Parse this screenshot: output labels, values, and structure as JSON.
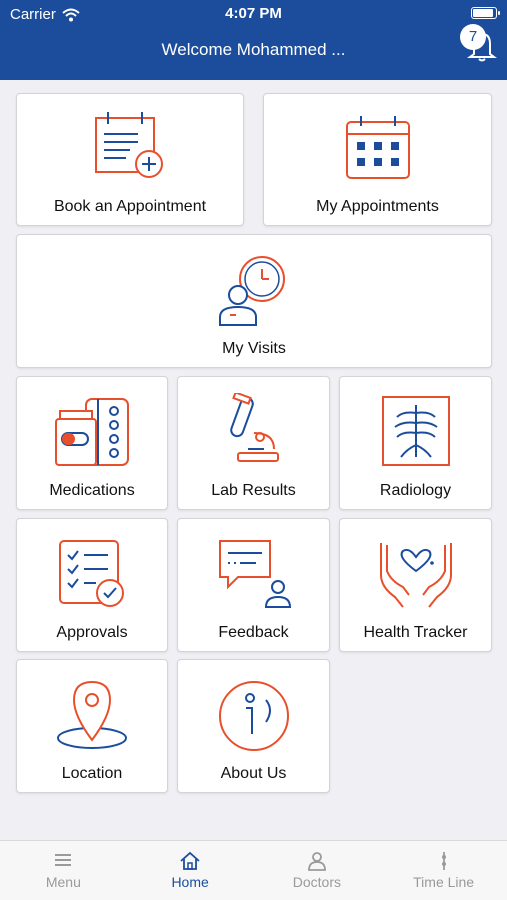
{
  "status_bar": {
    "carrier": "Carrier",
    "time": "4:07 PM"
  },
  "header": {
    "welcome_text": "Welcome Mohammed ...",
    "notification_count": "7"
  },
  "tiles": {
    "book_appointment": "Book an Appointment",
    "my_appointments": "My Appointments",
    "my_visits": "My Visits",
    "medications": "Medications",
    "lab_results": "Lab Results",
    "radiology": "Radiology",
    "approvals": "Approvals",
    "feedback": "Feedback",
    "health_tracker": "Health Tracker",
    "location": "Location",
    "about_us": "About Us"
  },
  "tabbar": {
    "menu": "Menu",
    "home": "Home",
    "doctors": "Doctors",
    "timeline": "Time Line",
    "active": "Home"
  },
  "colors": {
    "primary": "#1b4d9c",
    "accent": "#e8502c",
    "background": "#efeff4"
  }
}
